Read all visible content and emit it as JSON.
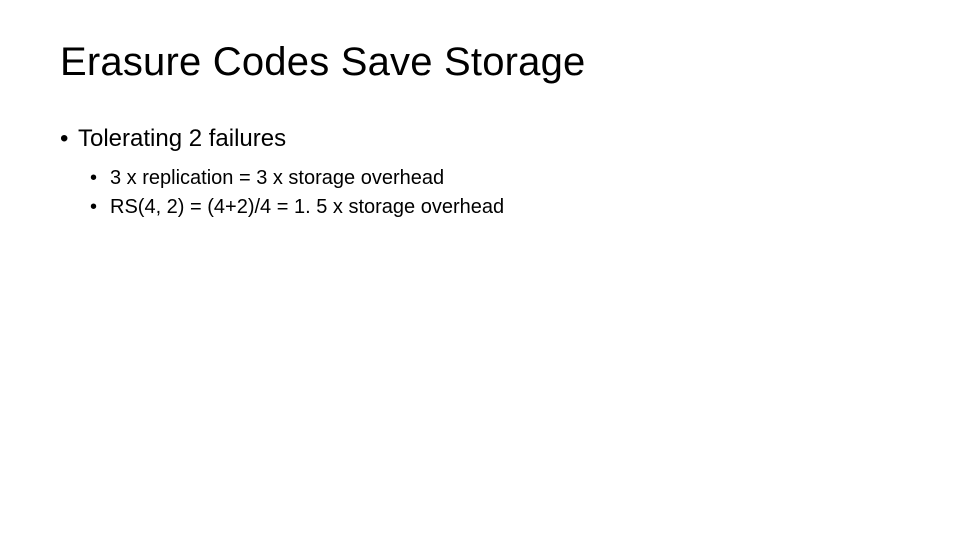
{
  "slide": {
    "title": "Erasure Codes Save Storage",
    "bullets": {
      "main": "Tolerating 2 failures",
      "sub1": "3 x replication = 3 x storage overhead",
      "sub2": "RS(4, 2) = (4+2)/4 = 1. 5 x storage overhead"
    }
  }
}
